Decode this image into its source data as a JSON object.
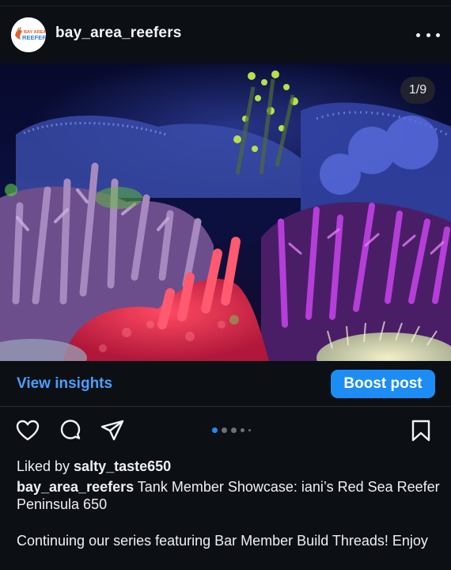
{
  "post": {
    "username": "bay_area_reefers",
    "avatar_text": "BAY AREA REEFERS",
    "image_counter": "1/9",
    "image_description_icon": "coral-reef-photo",
    "page_index": 1,
    "page_total": 9
  },
  "insights": {
    "view_label": "View insights",
    "boost_label": "Boost post"
  },
  "actions": {
    "like_icon": "heart-icon",
    "comment_icon": "comment-icon",
    "share_icon": "send-icon",
    "save_icon": "bookmark-icon"
  },
  "likes": {
    "prefix": "Liked by ",
    "user": "salty_taste650"
  },
  "caption": {
    "username": "bay_area_reefers",
    "text": " Tank Member Showcase: iani’s Red Sea Reefer Peninsula 650",
    "paragraph": "Continuing our series featuring Bar Member Build Threads! Enjoy"
  },
  "colors": {
    "background": "#0c0f14",
    "accent_link": "#4a9fff",
    "boost_button": "#1d8cf5",
    "active_dot": "#1d8cf5"
  }
}
